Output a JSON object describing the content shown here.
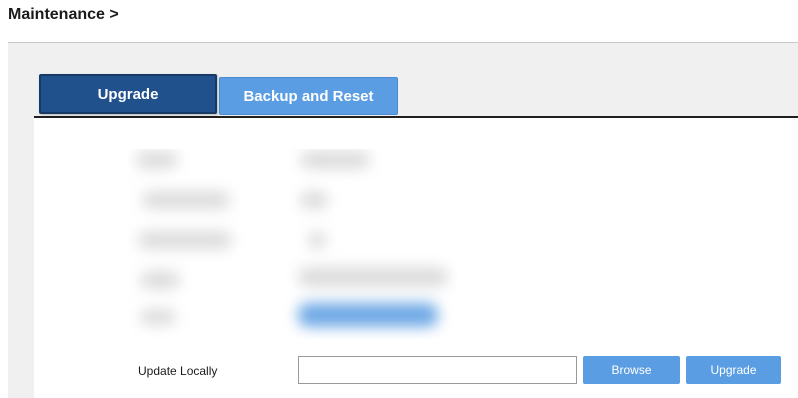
{
  "breadcrumb": {
    "title": "Maintenance >"
  },
  "tabs": [
    {
      "label": "Upgrade",
      "active": true
    },
    {
      "label": "Backup and Reset",
      "active": false
    }
  ],
  "upgrade_panel": {
    "update_locally_label": "Update Locally",
    "file_input": {
      "value": "",
      "placeholder": ""
    },
    "browse_label": "Browse",
    "upgrade_label": "Upgrade"
  },
  "colors": {
    "tab_active": "#21518d",
    "tab_inactive": "#5b9de2",
    "button": "#5b9de2",
    "panel_bg": "#f0f0f0"
  }
}
